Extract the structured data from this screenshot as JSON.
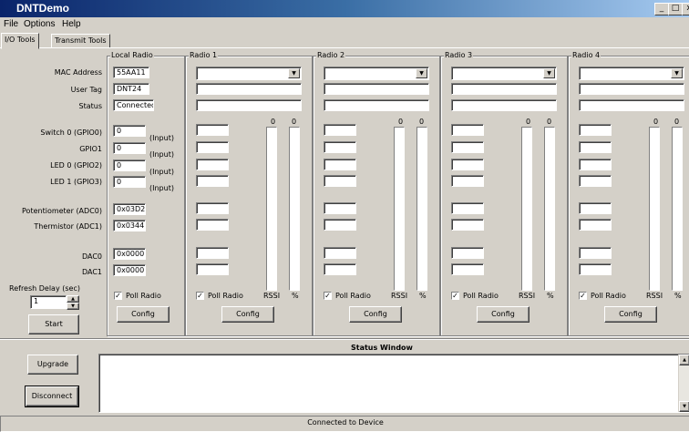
{
  "window": {
    "title": "DNTDemo",
    "minimize": "_",
    "maximize": "□",
    "close": "x"
  },
  "menu": [
    "File",
    "Options",
    "Help"
  ],
  "tabs": [
    "I/O Tools",
    "Transmit Tools"
  ],
  "labels": {
    "mac": "MAC Address",
    "user_tag": "User Tag",
    "status": "Status",
    "switch0": "Switch 0 (GPIO0)",
    "gpio1": "GPIO1",
    "led0": "LED 0 (GPIO2)",
    "led1": "LED 1 (GPIO3)",
    "pot": "Potentiometer (ADC0)",
    "therm": "Thermistor (ADC1)",
    "dac0": "DAC0",
    "dac1": "DAC1",
    "refresh": "Refresh Delay (sec)"
  },
  "local": {
    "title": "Local Radio",
    "mac": "55AA11",
    "user_tag": "DNT24",
    "status": "Connected",
    "gpio": [
      "0",
      "0",
      "0",
      "0"
    ],
    "gpio_note": "(Input)",
    "adc0": "0x03D2",
    "adc1": "0x0344",
    "dac0": "0x0000",
    "dac1": "0x0000",
    "poll_label": "Poll Radio",
    "poll_checked": true,
    "config_label": "Config"
  },
  "refresh": {
    "value": "1",
    "start_label": "Start"
  },
  "remote": {
    "rssi_label": "RSSI",
    "pct_label": "%",
    "poll_label": "Poll Radio",
    "config_label": "Config",
    "radios": [
      {
        "title": "Radio 1",
        "rssi_value": "0",
        "pct_value": "0",
        "poll_checked": true
      },
      {
        "title": "Radio 2",
        "rssi_value": "0",
        "pct_value": "0",
        "poll_checked": true
      },
      {
        "title": "Radio 3",
        "rssi_value": "0",
        "pct_value": "0",
        "poll_checked": true
      },
      {
        "title": "Radio 4",
        "rssi_value": "0",
        "pct_value": "0",
        "poll_checked": true
      }
    ]
  },
  "status_window": {
    "title": "Status Window",
    "upgrade_label": "Upgrade",
    "disconnect_label": "Disconnect"
  },
  "statusbar": {
    "text": "Connected to Device"
  }
}
